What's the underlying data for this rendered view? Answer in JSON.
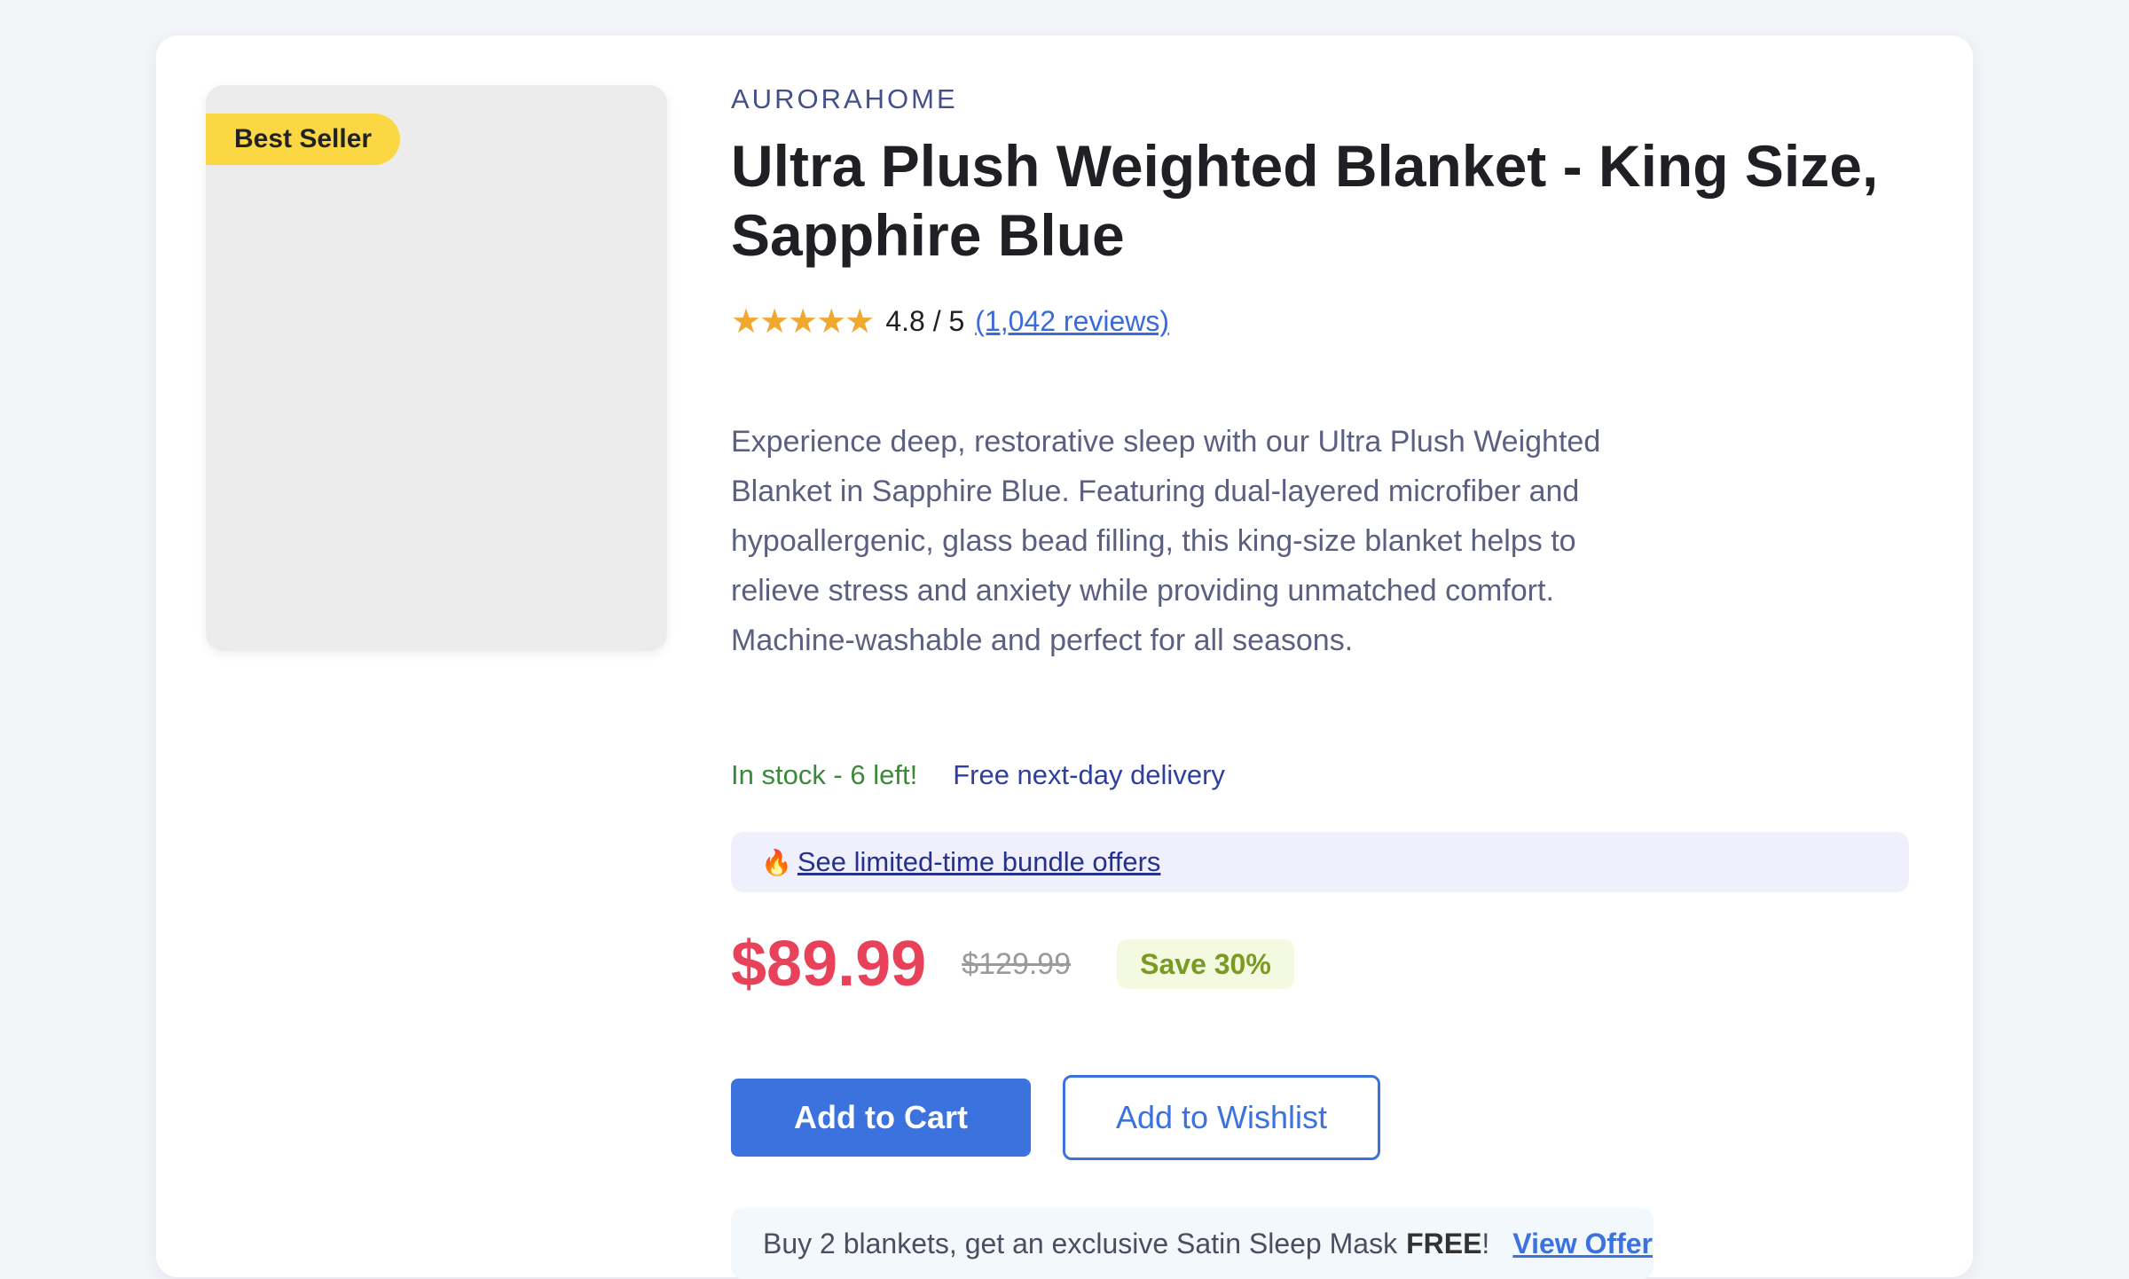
{
  "product": {
    "badge": "Best Seller",
    "brand": "AURORAHOME",
    "title": "Ultra Plush Weighted Blanket - King Size, Sapphire Blue",
    "rating": {
      "stars": "★★★★★",
      "value": 4.8,
      "text": "4.8 / 5",
      "reviews_link": "(1,042 reviews)"
    },
    "description": "Experience deep, restorative sleep with our Ultra Plush Weighted Blanket in Sapphire Blue. Featuring dual-layered microfiber and hypoallergenic, glass bead filling, this king-size blanket helps to relieve stress and anxiety while providing unmatched comfort. Machine-washable and perfect for all seasons.",
    "stock": "In stock - 6 left!",
    "delivery": "Free next-day delivery",
    "bundle": {
      "icon": "fire-icon",
      "link": "See limited-time bundle offers"
    },
    "pricing": {
      "price": "$89.99",
      "original_price": "$129.99",
      "savings": "Save 30%"
    },
    "actions": {
      "add_to_cart": "Add to Cart",
      "add_to_wishlist": "Add to Wishlist"
    },
    "promo": {
      "text": "Buy 2 blankets, get an exclusive Satin Sleep Mask",
      "bold": "FREE",
      "suffix": "!",
      "link": "View Offer"
    }
  },
  "colors": {
    "accent": "#3b72de",
    "price": "#e8425a",
    "badge": "#fbd843",
    "stock": "#3a8a3a"
  }
}
